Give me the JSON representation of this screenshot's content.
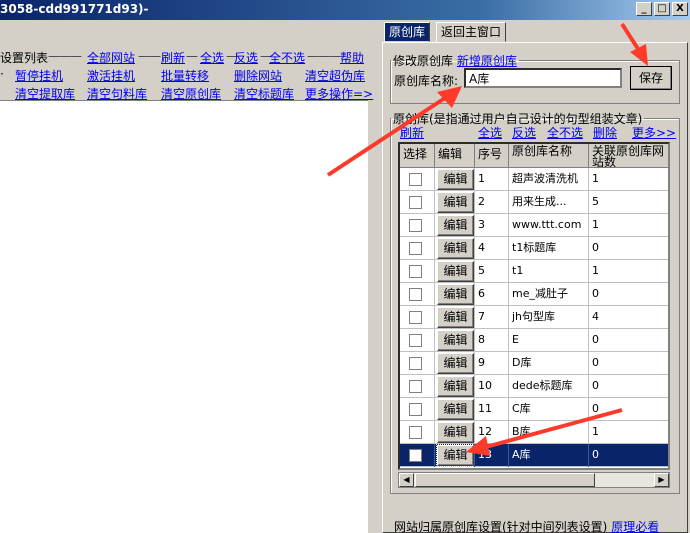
{
  "window": {
    "title": "3058-cdd991771d93)-",
    "min": "_",
    "max": "□",
    "close": "X"
  },
  "left": {
    "row1": [
      "设置列表",
      "全部网站",
      "刷新",
      "全选",
      "反选",
      "全不选",
      "帮助"
    ],
    "row2": [
      "暂停挂机",
      "激活挂机",
      "批量转移",
      "删除网站",
      "清空超伪库"
    ],
    "row3": [
      "清空提取库",
      "清空句料库",
      "清空原创库",
      "清空标题库",
      "更多操作=>"
    ]
  },
  "tabs": [
    "原创库",
    "返回主窗口"
  ],
  "modify": {
    "legend": "修改原创库",
    "new_link": "新增原创库",
    "name_label": "原创库名称:",
    "name_value": "A库",
    "save": "保存"
  },
  "library": {
    "legend": "原创库(是指通过用户自己设计的句型组装文章)",
    "links": [
      "刷新",
      "全选",
      "反选",
      "全不选",
      "删除",
      "更多>>"
    ],
    "headers": [
      "选择",
      "编辑",
      "序号",
      "原创库名称",
      "关联原创库网站数"
    ],
    "edit_label": "编辑",
    "rows": [
      {
        "no": "1",
        "name": "超声波清洗机",
        "count": "1"
      },
      {
        "no": "2",
        "name": "用来生成...",
        "count": "5"
      },
      {
        "no": "3",
        "name": "www.ttt.com",
        "count": "1"
      },
      {
        "no": "4",
        "name": "t1标题库",
        "count": "0"
      },
      {
        "no": "5",
        "name": "t1",
        "count": "1"
      },
      {
        "no": "6",
        "name": "me_减肚子",
        "count": "0"
      },
      {
        "no": "7",
        "name": "jh句型库",
        "count": "4"
      },
      {
        "no": "8",
        "name": "E",
        "count": "0"
      },
      {
        "no": "9",
        "name": "D库",
        "count": "0"
      },
      {
        "no": "10",
        "name": "dede标题库",
        "count": "0"
      },
      {
        "no": "11",
        "name": "C库",
        "count": "0"
      },
      {
        "no": "12",
        "name": "B库",
        "count": "1"
      },
      {
        "no": "13",
        "name": "A库",
        "count": "0"
      }
    ],
    "selected_index": 12
  },
  "bottom": {
    "legend": "网站归属原创库设置(针对中间列表设置)",
    "link": "原理必看"
  },
  "colors": {
    "selection": "#0a246a",
    "annotation": "#ff3a2a"
  }
}
